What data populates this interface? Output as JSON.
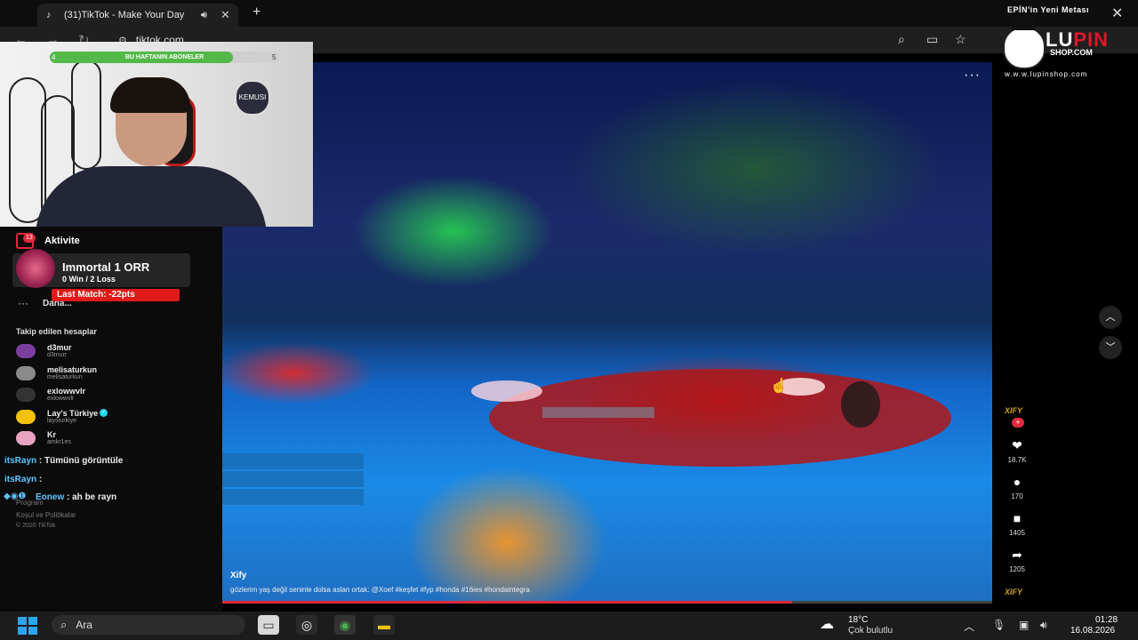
{
  "browser": {
    "tab_title": "(31)TikTok - Make Your Day",
    "tab_icon": "tiktok-icon",
    "sound_icon": "speaker-icon",
    "close_icon": "close-icon",
    "new_tab": "+",
    "window_close": "✕",
    "url": "tiktok.com",
    "toolbar_icons": [
      "zoom-icon",
      "cast-icon",
      "star-icon"
    ]
  },
  "webcam": {
    "subscriber_goal_label": "BU HAFTANIN ABONELER",
    "subscriber_current": "4",
    "subscriber_target": "5",
    "subscriber_progress": 0.8,
    "badge_text": "KEMUSI"
  },
  "sidebar": {
    "activity_label": "Aktivite",
    "activity_badge": "13",
    "more_label": "Daha...",
    "following_header": "Takip edilen hesaplar",
    "accounts": [
      {
        "name": "d3mur",
        "username": "d3murr",
        "color": "#7b3fa0",
        "verified": false
      },
      {
        "name": "melisaturkun",
        "username": "melisaturkun",
        "color": "#8a8a8a",
        "verified": false
      },
      {
        "name": "exlowwvlr",
        "username": "exlowwvlr",
        "color": "#333333",
        "verified": false
      },
      {
        "name": "Lay's Türkiye",
        "username": "laysturkiye",
        "color": "#f4c20d",
        "verified": true
      },
      {
        "name": "Kr",
        "username": "amkr1es",
        "color": "#e7a3c0",
        "verified": false
      }
    ],
    "footer_program": "Program",
    "footer_terms": "Koşul ve Politikalar",
    "footer_copyright": "© 2026 TikTok"
  },
  "rank_overlay": {
    "title": "Immortal 1  ORR",
    "record": "0 Win / 2 Loss",
    "last_match": "Last Match: -22pts"
  },
  "chat": [
    {
      "user": "itsRayn",
      "message": ": Tümünü görüntüle"
    },
    {
      "user": "itsRayn",
      "message": ":"
    },
    {
      "user": "Eonew",
      "message": ": ah be rayn"
    }
  ],
  "video": {
    "author": "Xify",
    "caption": "gözlerim yaş değil seninle dolsa aslan ortak: @Xoef #keşfet #fyp #honda #16ies #hondaintegra",
    "menu": "···",
    "progress": 0.74,
    "creator_mark": "XIFY",
    "creator_plus": "+",
    "actions": [
      {
        "icon": "heart-icon",
        "glyph": "❤",
        "count": "18.7K"
      },
      {
        "icon": "comment-icon",
        "glyph": "●",
        "count": "170"
      },
      {
        "icon": "bookmark-icon",
        "glyph": "■",
        "count": "1405"
      },
      {
        "icon": "share-icon",
        "glyph": "➦",
        "count": "1205"
      }
    ],
    "nav_up": "︿",
    "nav_down": "﹀"
  },
  "lupin": {
    "tagline": "EPİN'in Yeni Metası",
    "logo_lu": "LU",
    "logo_pin": "PIN",
    "shop": "SHOP.COM",
    "url": "w.w.w.lupinshop.com"
  },
  "taskbar": {
    "search_placeholder": "Ara",
    "weather_temp": "18°C",
    "weather_desc": "Çok bulutlu",
    "time": "01:28",
    "date": "16.08.2026"
  }
}
